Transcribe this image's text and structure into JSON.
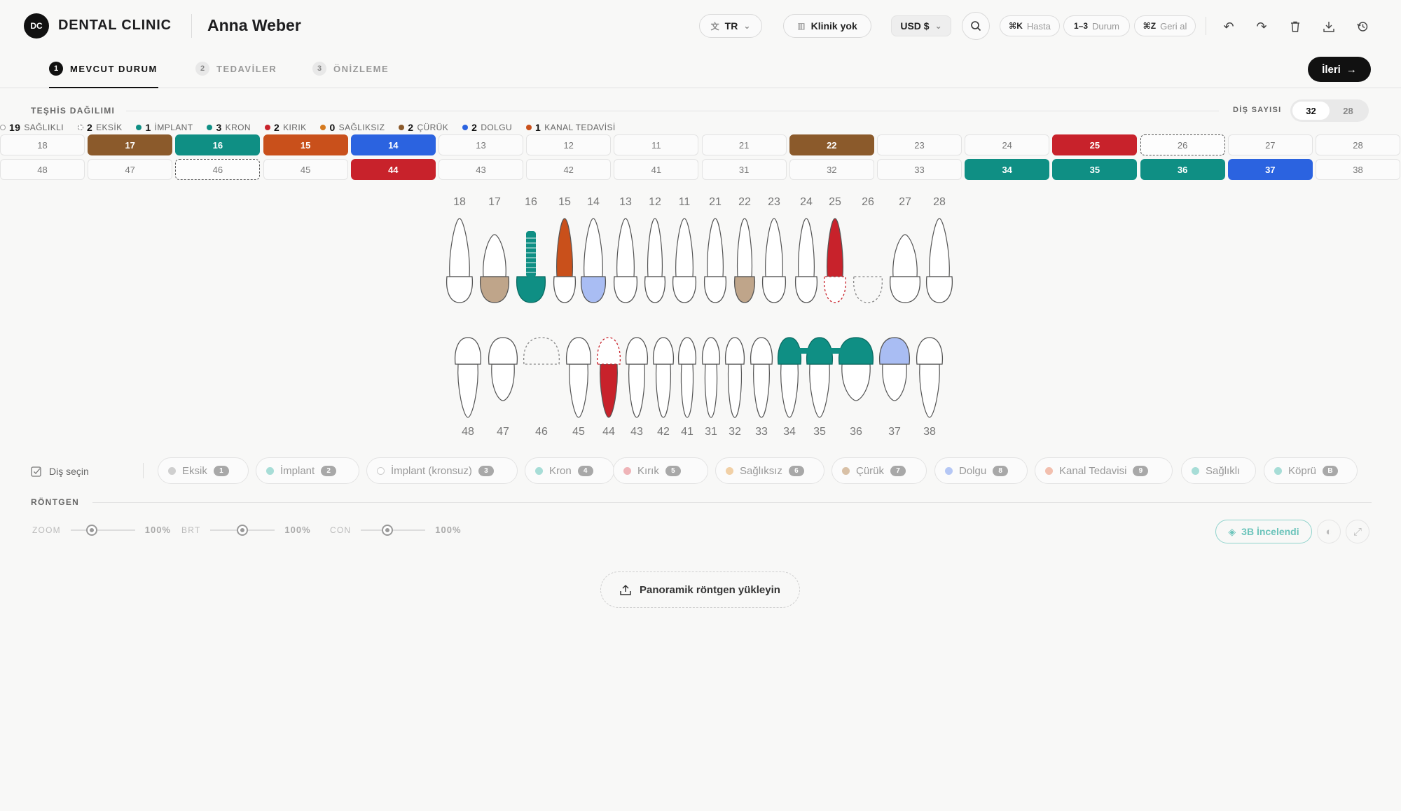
{
  "header": {
    "logo": "DC",
    "brand": "DENTAL CLINIC",
    "patient": "Anna Weber",
    "language": "TR",
    "clinic": "Klinik yok",
    "currency": "USD $",
    "shortcuts": [
      {
        "key": "⌘K",
        "label": "Hasta"
      },
      {
        "key": "1–3",
        "label": "Durum"
      },
      {
        "key": "⌘Z",
        "label": "Geri al"
      }
    ]
  },
  "tabs": [
    {
      "num": "1",
      "label": "MEVCUT DURUM"
    },
    {
      "num": "2",
      "label": "TEDAVİLER"
    },
    {
      "num": "3",
      "label": "ÖNİZLEME"
    }
  ],
  "next_button": "İleri",
  "diagnosis": {
    "title": "TEŞHİS DAĞILIMI",
    "count_label": "DİŞ SAYISI",
    "count_options": [
      "32",
      "28"
    ],
    "legend": [
      {
        "count": "19",
        "label": "SAĞLIKLI",
        "color": "#ffffff"
      },
      {
        "count": "2",
        "label": "EKSİK",
        "color": "#ffffff"
      },
      {
        "count": "1",
        "label": "İMPLANT",
        "color": "#0f8f84"
      },
      {
        "count": "3",
        "label": "KRON",
        "color": "#0f8f84"
      },
      {
        "count": "2",
        "label": "KIRIK",
        "color": "#c8222b"
      },
      {
        "count": "0",
        "label": "SAĞLIKSIZ",
        "color": "#d57a1f"
      },
      {
        "count": "2",
        "label": "ÇÜRÜK",
        "color": "#8b5a2b"
      },
      {
        "count": "2",
        "label": "DOLGU",
        "color": "#2b63e0"
      },
      {
        "count": "1",
        "label": "KANAL TEDAVİSİ",
        "color": "#c9501b"
      }
    ]
  },
  "grid": {
    "upper": [
      {
        "n": "18",
        "s": "healthy"
      },
      {
        "n": "17",
        "s": "caries"
      },
      {
        "n": "16",
        "s": "implant"
      },
      {
        "n": "15",
        "s": "root"
      },
      {
        "n": "14",
        "s": "filling"
      },
      {
        "n": "13",
        "s": "healthy"
      },
      {
        "n": "12",
        "s": "healthy"
      },
      {
        "n": "11",
        "s": "healthy"
      },
      {
        "n": "21",
        "s": "healthy"
      },
      {
        "n": "22",
        "s": "caries"
      },
      {
        "n": "23",
        "s": "healthy"
      },
      {
        "n": "24",
        "s": "healthy"
      },
      {
        "n": "25",
        "s": "fracture"
      },
      {
        "n": "26",
        "s": "missing"
      },
      {
        "n": "27",
        "s": "healthy"
      },
      {
        "n": "28",
        "s": "healthy"
      }
    ],
    "lower": [
      {
        "n": "48",
        "s": "healthy"
      },
      {
        "n": "47",
        "s": "healthy"
      },
      {
        "n": "46",
        "s": "missing"
      },
      {
        "n": "45",
        "s": "healthy"
      },
      {
        "n": "44",
        "s": "fracture"
      },
      {
        "n": "43",
        "s": "healthy"
      },
      {
        "n": "42",
        "s": "healthy"
      },
      {
        "n": "41",
        "s": "healthy"
      },
      {
        "n": "31",
        "s": "healthy"
      },
      {
        "n": "32",
        "s": "healthy"
      },
      {
        "n": "33",
        "s": "healthy"
      },
      {
        "n": "34",
        "s": "crown"
      },
      {
        "n": "35",
        "s": "crown"
      },
      {
        "n": "36",
        "s": "crown"
      },
      {
        "n": "37",
        "s": "filling"
      },
      {
        "n": "38",
        "s": "healthy"
      }
    ]
  },
  "status_colors": {
    "caries": "#8b5a2b",
    "implant": "#0f8f84",
    "crown": "#0f8f84",
    "root": "#c9501b",
    "filling": "#2b63e0",
    "fracture": "#c8222b"
  },
  "chart_numbers": {
    "upper": [
      "18",
      "17",
      "16",
      "15",
      "14",
      "13",
      "12",
      "11",
      "21",
      "22",
      "23",
      "24",
      "25",
      "26",
      "27",
      "28"
    ],
    "lower": [
      "48",
      "47",
      "46",
      "45",
      "44",
      "43",
      "42",
      "41",
      "31",
      "32",
      "33",
      "34",
      "35",
      "36",
      "37",
      "38"
    ]
  },
  "tools": {
    "select_label": "Diş seçin",
    "chips": [
      {
        "label": "Eksik",
        "key": "1",
        "color": "#cfcfcf"
      },
      {
        "label": "İmplant",
        "key": "2",
        "color": "#a7ddd7"
      },
      {
        "label": "İmplant (kronsuz)",
        "key": "3",
        "color": "#ffffff"
      },
      {
        "label": "Kron",
        "key": "4",
        "color": "#a7ddd7"
      },
      {
        "label": "Kırık",
        "key": "5",
        "color": "#efb4b8"
      },
      {
        "label": "Sağlıksız",
        "key": "6",
        "color": "#f1d0a6"
      },
      {
        "label": "Çürük",
        "key": "7",
        "color": "#d8c0a6"
      },
      {
        "label": "Dolgu",
        "key": "8",
        "color": "#b5c7f5"
      },
      {
        "label": "Kanal Tedavisi",
        "key": "9",
        "color": "#f2bfae"
      },
      {
        "label": "Sağlıklı",
        "key": "",
        "color": "#a7ddd7"
      },
      {
        "label": "Köprü",
        "key": "B",
        "color": "#a7ddd7"
      }
    ]
  },
  "xray": {
    "title": "RÖNTGEN",
    "sliders": [
      {
        "label": "ZOOM",
        "value": "100%"
      },
      {
        "label": "BRT",
        "value": "100%"
      },
      {
        "label": "CON",
        "value": "100%"
      }
    ],
    "ai_button": "3B İncelendi",
    "upload_label": "Panoramik röntgen yükleyin"
  }
}
